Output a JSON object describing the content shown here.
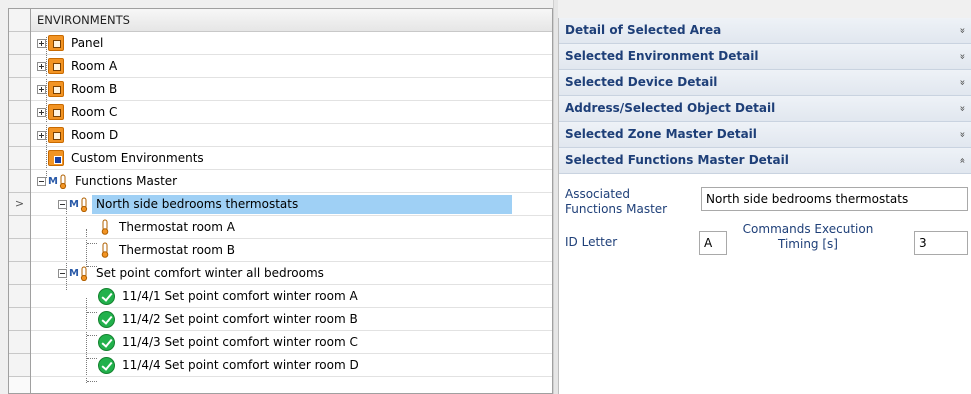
{
  "tree": {
    "header": "ENVIRONMENTS",
    "current_row_marker": ">",
    "nodes": [
      {
        "label": "Panel",
        "icon": "environment-icon"
      },
      {
        "label": "Room A",
        "icon": "environment-icon"
      },
      {
        "label": "Room B",
        "icon": "environment-icon"
      },
      {
        "label": "Room C",
        "icon": "environment-icon"
      },
      {
        "label": "Room D",
        "icon": "environment-icon"
      },
      {
        "label": "Custom Environments",
        "icon": "custom-environment-icon"
      },
      {
        "label": "Functions Master",
        "icon": "functions-master-icon"
      },
      {
        "label": "North side bedrooms thermostats",
        "icon": "functions-master-icon"
      },
      {
        "label": "Thermostat room A",
        "icon": "thermostat-icon"
      },
      {
        "label": "Thermostat room B",
        "icon": "thermostat-icon"
      },
      {
        "label": "Set point comfort winter all bedrooms",
        "icon": "functions-master-icon"
      },
      {
        "label": "11/4/1 Set point comfort winter room A",
        "icon": "check-icon"
      },
      {
        "label": "11/4/2 Set point comfort winter room B",
        "icon": "check-icon"
      },
      {
        "label": "11/4/3 Set point comfort winter room C",
        "icon": "check-icon"
      },
      {
        "label": "11/4/4 Set point comfort winter room D",
        "icon": "check-icon"
      }
    ]
  },
  "details": {
    "sections": [
      {
        "title": "Detail of Selected Area"
      },
      {
        "title": "Selected Environment Detail"
      },
      {
        "title": "Selected Device Detail"
      },
      {
        "title": "Address/Selected Object Detail"
      },
      {
        "title": "Selected Zone Master Detail"
      },
      {
        "title": "Selected Functions Master Detail"
      }
    ],
    "collapsed_glyph": "»",
    "expanded_glyph": "«",
    "form": {
      "associated_label_1": "Associated",
      "associated_label_2": "Functions Master",
      "associated_value": "North side bedrooms thermostats",
      "id_letter_label": "ID Letter",
      "id_letter_value": "A",
      "timing_label_1": "Commands Execution",
      "timing_label_2": "Timing [s]",
      "timing_value": "3"
    }
  },
  "colors": {
    "selection": "#9fd0f5",
    "section_title": "#1e3f78",
    "environment_icon": "#f29424",
    "check_icon": "#22b14c"
  }
}
